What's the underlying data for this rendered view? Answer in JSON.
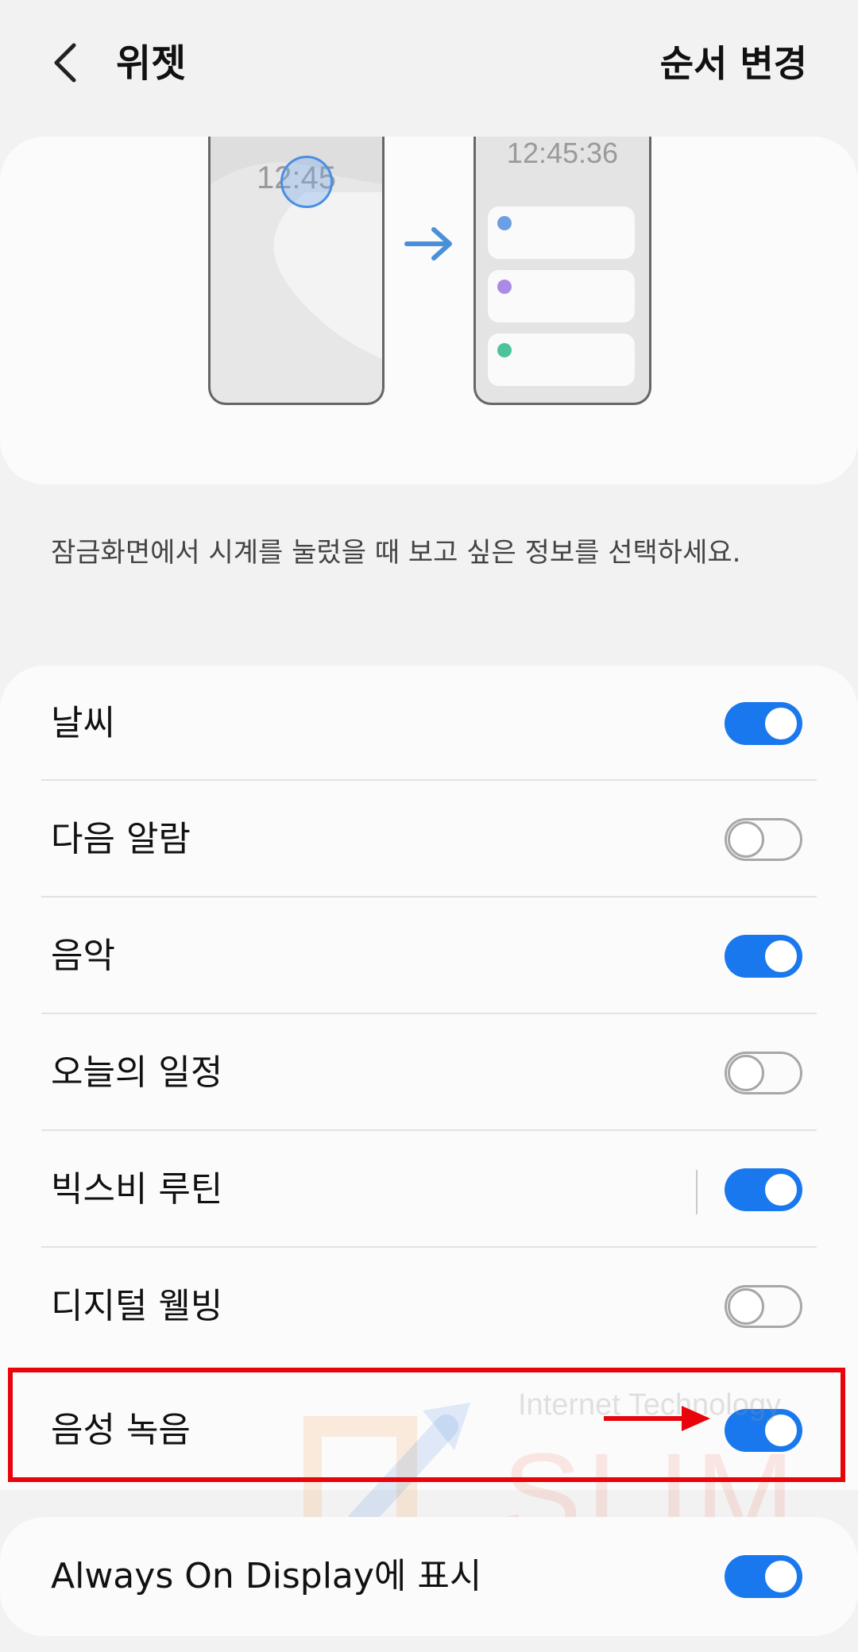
{
  "header": {
    "title": "위젯",
    "action_label": "순서 변경"
  },
  "preview": {
    "lock_time": "12:45",
    "aod_time": "12:45:36",
    "dot_colors": [
      "#6a9fe3",
      "#a98be6",
      "#4cc39a"
    ],
    "accent_color": "#4a90d9"
  },
  "description": "잠금화면에서 시계를 눌렀을 때 보고 싶은 정보를 선택하세요.",
  "widgets": [
    {
      "label": "날씨",
      "enabled": true
    },
    {
      "label": "다음 알람",
      "enabled": false
    },
    {
      "label": "음악",
      "enabled": true
    },
    {
      "label": "오늘의 일정",
      "enabled": false
    },
    {
      "label": "빅스비 루틴",
      "enabled": true
    },
    {
      "label": "디지털 웰빙",
      "enabled": false
    },
    {
      "label": "음성 녹음",
      "enabled": true
    }
  ],
  "aod": {
    "label": "Always On Display에 표시",
    "enabled": true
  },
  "watermark": {
    "small_text": "Internet Technology",
    "big_text": "SLIM"
  },
  "colors": {
    "toggle_on": "#1a78ee",
    "highlight": "#e8040a"
  }
}
